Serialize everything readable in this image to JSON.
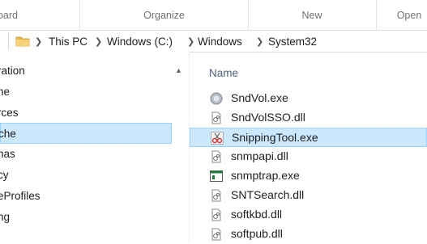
{
  "ribbon": {
    "groups": [
      "board",
      "Organize",
      "New",
      "Open"
    ]
  },
  "address": {
    "crumbs": [
      "This PC",
      "Windows (C:)",
      "Windows",
      "System32"
    ]
  },
  "nav": {
    "items": [
      {
        "label": "ration",
        "selected": false
      },
      {
        "label": "he",
        "selected": false
      },
      {
        "label": "rces",
        "selected": false
      },
      {
        "label": "che",
        "selected": true
      },
      {
        "label": "nas",
        "selected": false
      },
      {
        "label": "cy",
        "selected": false
      },
      {
        "label": "eProfiles",
        "selected": false
      },
      {
        "label": "ng",
        "selected": false
      }
    ]
  },
  "filelist": {
    "column_header": "Name",
    "files": [
      {
        "name": "SndVol.exe",
        "icon": "volume-app-icon"
      },
      {
        "name": "SndVolSSO.dll",
        "icon": "dll-file-icon"
      },
      {
        "name": "SnippingTool.exe",
        "icon": "scissors-app-icon"
      },
      {
        "name": "snmpapi.dll",
        "icon": "dll-file-icon"
      },
      {
        "name": "snmptrap.exe",
        "icon": "console-app-icon"
      },
      {
        "name": "SNTSearch.dll",
        "icon": "dll-file-icon"
      },
      {
        "name": "softkbd.dll",
        "icon": "dll-file-icon"
      },
      {
        "name": "softpub.dll",
        "icon": "dll-file-icon"
      }
    ],
    "selected_index": 2
  }
}
